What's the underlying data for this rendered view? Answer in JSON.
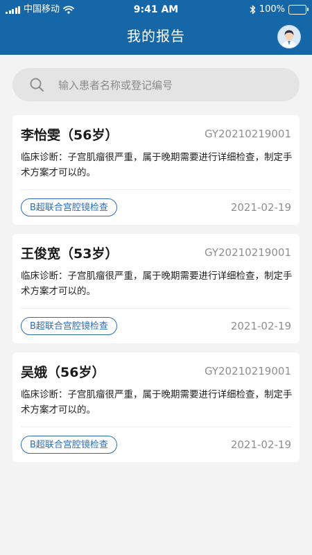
{
  "status_bar": {
    "carrier": "中国移动",
    "time": "9:41 AM",
    "battery": "100%"
  },
  "header": {
    "title": "我的报告",
    "avatar_icon": "doctor-avatar-icon"
  },
  "search": {
    "placeholder": "输入患者名称或登记编号",
    "value": ""
  },
  "reports": [
    {
      "name": "李怡雯（56岁）",
      "code": "GY20210219001",
      "diagnosis": "临床诊断：子宫肌瘤很严重，属于晚期需要进行详细检查，制定手术方案才可以的。",
      "tag": "B超联合宫腔镜检查",
      "date": "2021-02-19"
    },
    {
      "name": "王俊宽（53岁）",
      "code": "GY20210219001",
      "diagnosis": "临床诊断：子宫肌瘤很严重，属于晚期需要进行详细检查，制定手术方案才可以的。",
      "tag": "B超联合宫腔镜检查",
      "date": "2021-02-19"
    },
    {
      "name": "吴娥（56岁）",
      "code": "GY20210219001",
      "diagnosis": "临床诊断：子宫肌瘤很严重，属于晚期需要进行详细检查，制定手术方案才可以的。",
      "tag": "B超联合宫腔镜检查",
      "date": "2021-02-19"
    }
  ],
  "colors": {
    "header": "#1667a8",
    "accent": "#2b6cb8",
    "background": "#f3f3f3"
  }
}
